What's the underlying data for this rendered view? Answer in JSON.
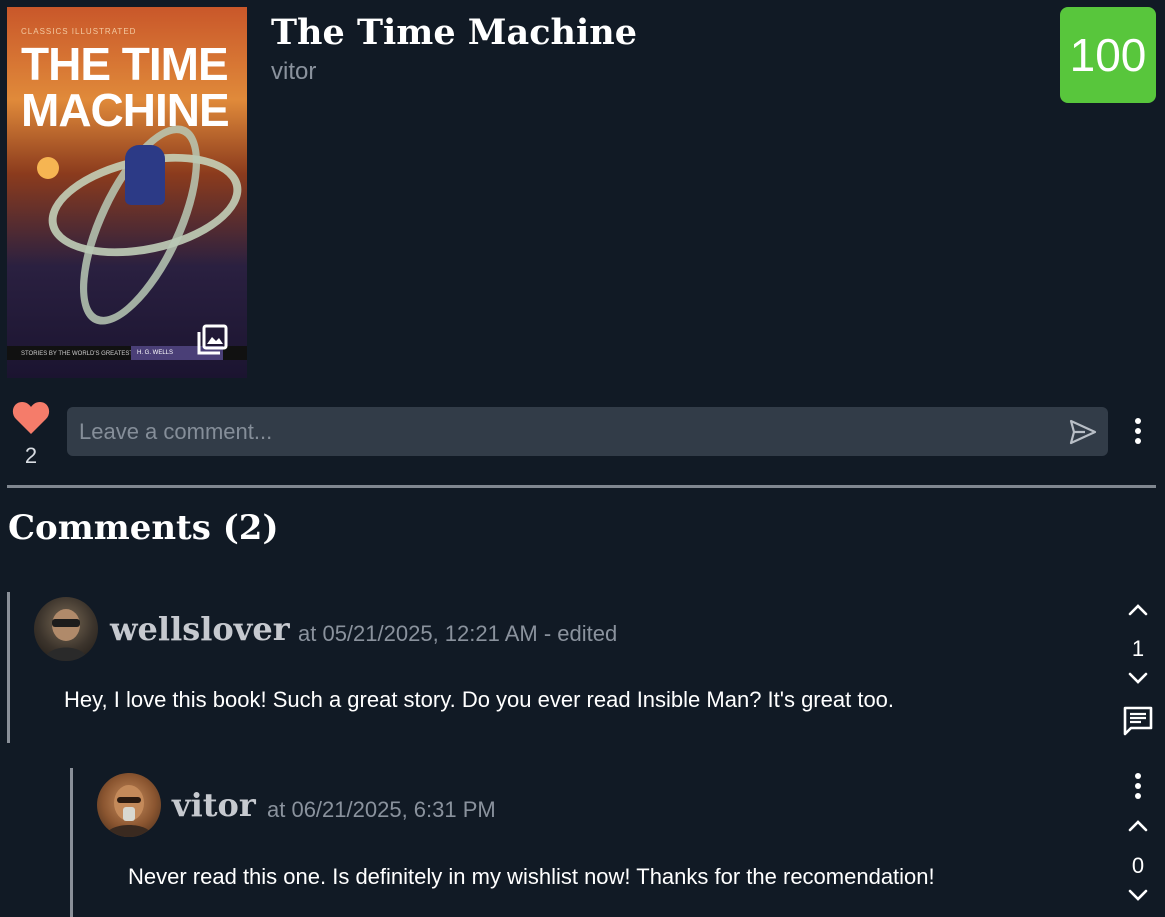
{
  "book": {
    "title": "The Time Machine",
    "owner": "vitor",
    "score": "100",
    "score_color": "#58c63c",
    "cover": {
      "series_label": "CLASSICS ILLUSTRATED",
      "title_text": "THE TIME MACHINE",
      "bottom_label": "STORIES BY THE WORLD'S GREATEST AUTHORS",
      "author": "H. G. WELLS"
    }
  },
  "actions": {
    "like_icon": "heart-icon",
    "like_count": "2",
    "like_color": "#f57c6a",
    "comment_placeholder": "Leave a comment...",
    "send_icon": "send-icon",
    "more_icon": "kebab-icon"
  },
  "comments": {
    "heading": "Comments (2)",
    "items": [
      {
        "username": "wellslover",
        "meta": "at 05/21/2025, 12:21 AM - edited",
        "text": "Hey, I love this book! Such a great story. Do you ever read Insible Man? It's great too.",
        "votes": "1"
      },
      {
        "username": "vitor",
        "meta": "at 06/21/2025, 6:31 PM",
        "text": "Never read this one. Is definitely in my wishlist now! Thanks for the recomendation!",
        "votes": "0"
      }
    ]
  }
}
